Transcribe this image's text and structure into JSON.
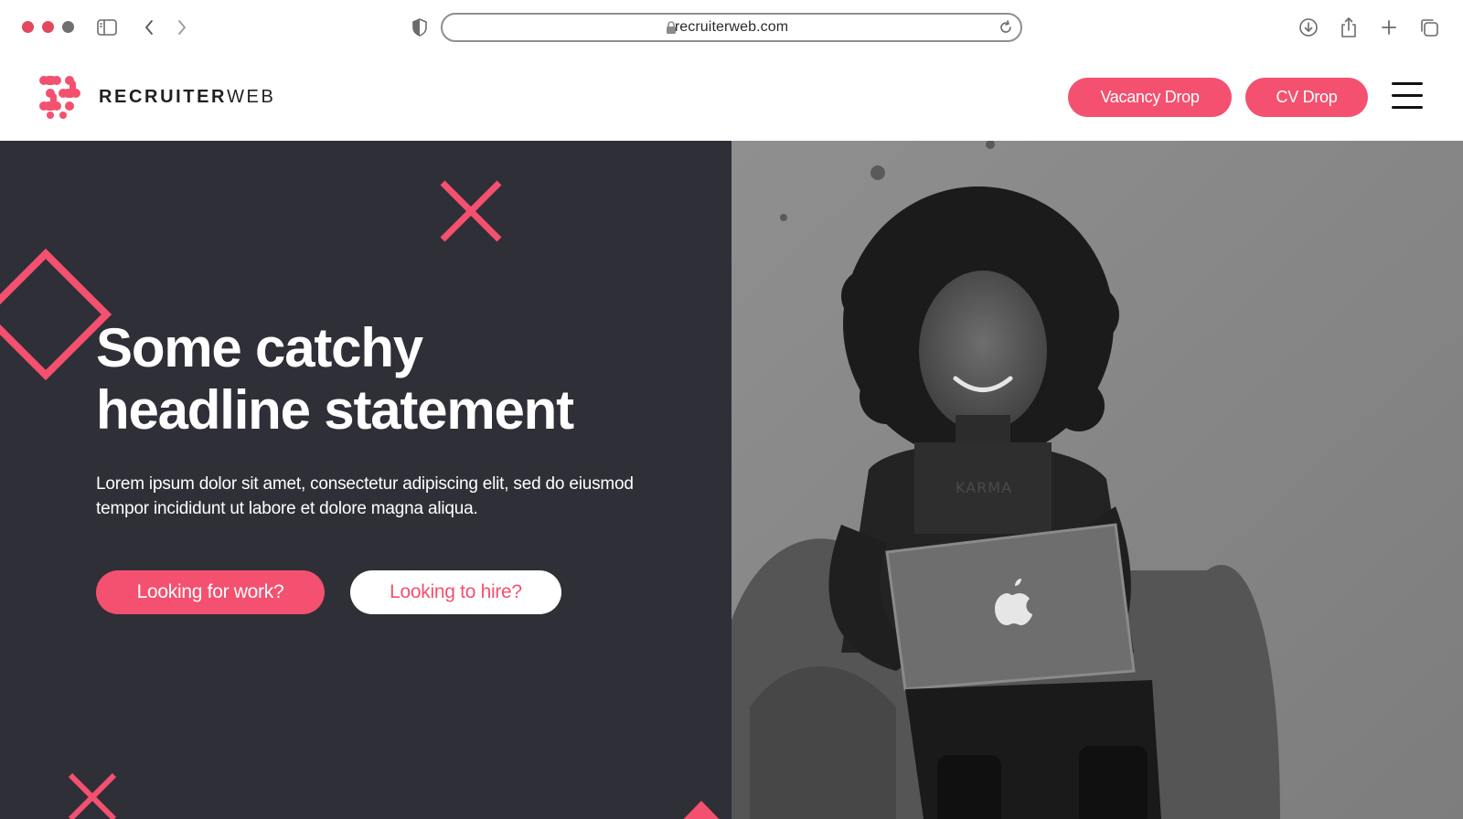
{
  "browser": {
    "url": "recruiterweb.com",
    "traffic_colors": [
      "#e0495f",
      "#e0495f",
      "#6f6f72"
    ]
  },
  "site": {
    "logo_bold": "RECRUITER",
    "logo_light": "WEB",
    "nav": {
      "vacancy_drop": "Vacancy Drop",
      "cv_drop": "CV Drop"
    }
  },
  "hero": {
    "headline_line1": "Some catchy",
    "headline_line2": "headline statement",
    "subtext": "Lorem ipsum dolor sit amet, consectetur adipiscing elit, sed do eiusmod tempor incididunt ut labore et dolore magna aliqua.",
    "cta_work": "Looking for work?",
    "cta_hire": "Looking to hire?",
    "image_icon": "woman-with-laptop-photo"
  },
  "colors": {
    "accent": "#f4506f",
    "hero_dark": "#2f2f37",
    "text_dark": "#1f1f24"
  }
}
